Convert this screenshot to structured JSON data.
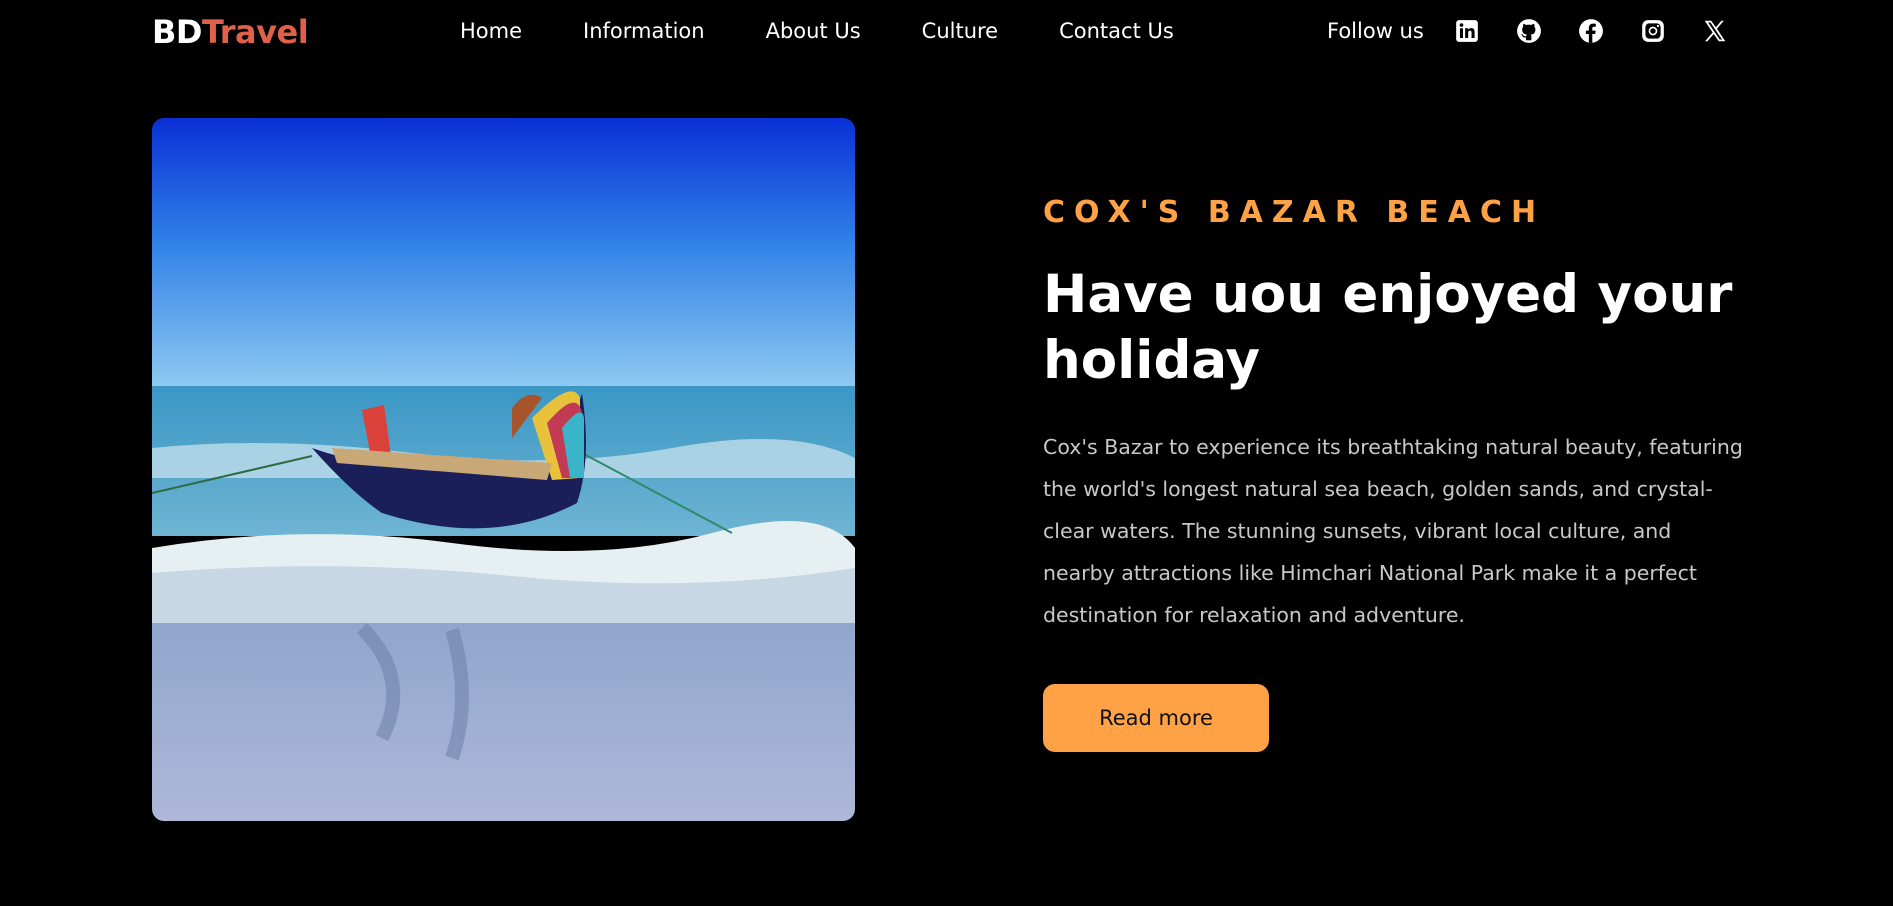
{
  "brand": {
    "part1": "BD",
    "part2": "Travel",
    "color_part1": "#ffffff",
    "color_part2": "#e0604a"
  },
  "nav": {
    "items": [
      {
        "label": "Home"
      },
      {
        "label": "Information"
      },
      {
        "label": "About Us"
      },
      {
        "label": "Culture"
      },
      {
        "label": "Contact Us"
      }
    ]
  },
  "social": {
    "label": "Follow us",
    "icons": [
      "linkedin-icon",
      "github-icon",
      "facebook-icon",
      "instagram-icon",
      "x-icon"
    ]
  },
  "hero": {
    "image_icon": "beach-boat-photo",
    "eyebrow": "COX'S BAZAR BEACH",
    "headline": "Have uou enjoyed your holiday",
    "description": "Cox's Bazar to experience its breathtaking natural beauty, featuring the world's longest natural sea beach, golden sands, and crystal-clear waters. The stunning sunsets, vibrant local culture, and nearby attractions like Himchari National Park make it a perfect destination for relaxation and adventure.",
    "cta_label": "Read more"
  },
  "colors": {
    "accent": "#ffa245",
    "background": "#000000",
    "body_text": "#c8c8c8"
  }
}
